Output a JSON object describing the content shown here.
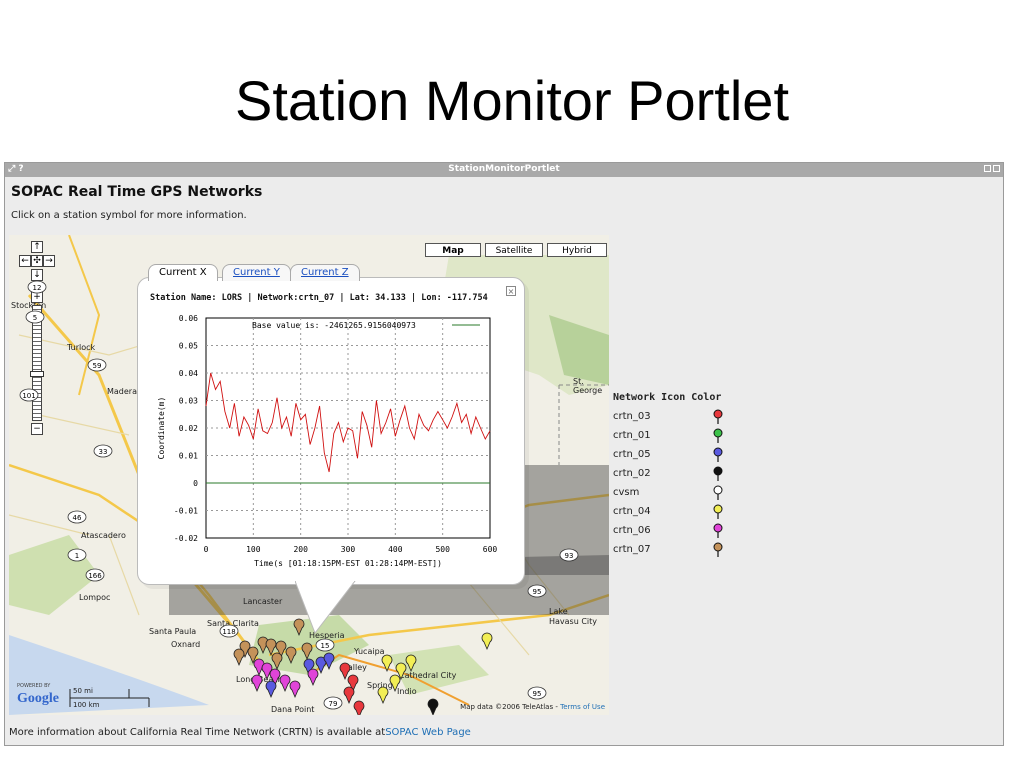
{
  "slide": {
    "title": "Station Monitor Portlet"
  },
  "portlet": {
    "titlebar_left": "⤢ ?",
    "title": "StationMonitorPortlet",
    "heading": "SOPAC Real Time GPS Networks",
    "instruction": "Click on a station symbol for more information."
  },
  "map": {
    "types": [
      "Map",
      "Satellite",
      "Hybrid"
    ],
    "selected_type": "Map",
    "zoom_level": "12",
    "attribution": "Map data ©2006 TeleAtlas - ",
    "terms_label": "Terms of Use",
    "scale_mi": "50 mi",
    "scale_km": "100 km",
    "powered_by": "POWERED BY",
    "logo": "Google",
    "places": [
      {
        "name": "Turlock"
      },
      {
        "name": "Stockton"
      },
      {
        "name": "Atascadero"
      },
      {
        "name": "Lompoc"
      },
      {
        "name": "Santa Paula"
      },
      {
        "name": "Oxnard"
      },
      {
        "name": "Santa Clarita"
      },
      {
        "name": "Lancaster"
      },
      {
        "name": "Hesperia"
      },
      {
        "name": "Yucaipa"
      },
      {
        "name": "Long Beach"
      },
      {
        "name": "Lake Havasu City"
      },
      {
        "name": "St. George"
      },
      {
        "name": "Cathedral City"
      },
      {
        "name": "Dana Point"
      },
      {
        "name": "Madera"
      },
      {
        "name": "Valley"
      },
      {
        "name": "Springs"
      },
      {
        "name": "Indio"
      }
    ]
  },
  "popup": {
    "tabs": [
      "Current X",
      "Current Y",
      "Current Z"
    ],
    "active_tab": "Current X",
    "station_name": "LORS",
    "network": "crtn_07",
    "lat": "34.133",
    "lon": "-117.754",
    "header_text": "Station Name: LORS | Network:crtn_07 | Lat: 34.133 | Lon: -117.754",
    "close_icon": "x-icon"
  },
  "chart_data": {
    "type": "line",
    "title": "",
    "xlabel": "Time(s [01:18:15PM-EST 01:28:14PM-EST])",
    "ylabel": "Coordinate(m)",
    "xlim": [
      0,
      600
    ],
    "ylim": [
      -0.02,
      0.06
    ],
    "x_ticks": [
      0,
      100,
      200,
      300,
      400,
      500,
      600
    ],
    "y_ticks": [
      0.06,
      0.05,
      0.04,
      0.03,
      0.02,
      0.01,
      0,
      -0.01,
      -0.02
    ],
    "y_tick_labels": [
      "0.06",
      "0.05",
      "0.04",
      "0.03",
      "0.02",
      "0.01",
      "0",
      "-0.01",
      "-0.02"
    ],
    "grid": true,
    "legend_text": "Base value is: -2461265.9156040973",
    "series": [
      {
        "color": "#d01010",
        "x": [
          0,
          10,
          20,
          30,
          40,
          50,
          60,
          70,
          80,
          90,
          100,
          110,
          120,
          130,
          140,
          150,
          160,
          170,
          180,
          190,
          200,
          210,
          220,
          230,
          240,
          250,
          260,
          270,
          280,
          290,
          300,
          310,
          320,
          330,
          340,
          350,
          360,
          370,
          380,
          390,
          400,
          410,
          420,
          430,
          440,
          450,
          460,
          470,
          480,
          490,
          500,
          510,
          520,
          530,
          540,
          550,
          560,
          570,
          580,
          590,
          600
        ],
        "values": [
          0.028,
          0.04,
          0.034,
          0.037,
          0.026,
          0.02,
          0.029,
          0.017,
          0.024,
          0.021,
          0.016,
          0.027,
          0.019,
          0.018,
          0.022,
          0.031,
          0.02,
          0.024,
          0.017,
          0.029,
          0.023,
          0.025,
          0.014,
          0.02,
          0.028,
          0.011,
          0.004,
          0.018,
          0.022,
          0.015,
          0.02,
          0.019,
          0.009,
          0.026,
          0.021,
          0.013,
          0.03,
          0.018,
          0.022,
          0.027,
          0.017,
          0.023,
          0.028,
          0.02,
          0.016,
          0.025,
          0.021,
          0.019,
          0.023,
          0.026,
          0.023,
          0.02,
          0.024,
          0.029,
          0.022,
          0.025,
          0.018,
          0.024,
          0.02,
          0.016,
          0.019
        ]
      },
      {
        "color": "#2a7a2a",
        "x": [
          0,
          600
        ],
        "values": [
          0,
          0
        ]
      }
    ]
  },
  "legend": {
    "title": "Network Icon Color",
    "items": [
      {
        "label": "crtn_03",
        "color": "#e8383d"
      },
      {
        "label": "crtn_01",
        "color": "#3cc24a"
      },
      {
        "label": "crtn_05",
        "color": "#5a5ae0"
      },
      {
        "label": "crtn_02",
        "color": "#111111"
      },
      {
        "label": "cvsm",
        "color": "#ffffff"
      },
      {
        "label": "crtn_04",
        "color": "#f2ee55"
      },
      {
        "label": "crtn_06",
        "color": "#e044d8"
      },
      {
        "label": "crtn_07",
        "color": "#c4925a"
      }
    ]
  },
  "footer": {
    "text": "More information about California Real Time Network (CRTN) is available at",
    "link": "SOPAC Web Page"
  }
}
